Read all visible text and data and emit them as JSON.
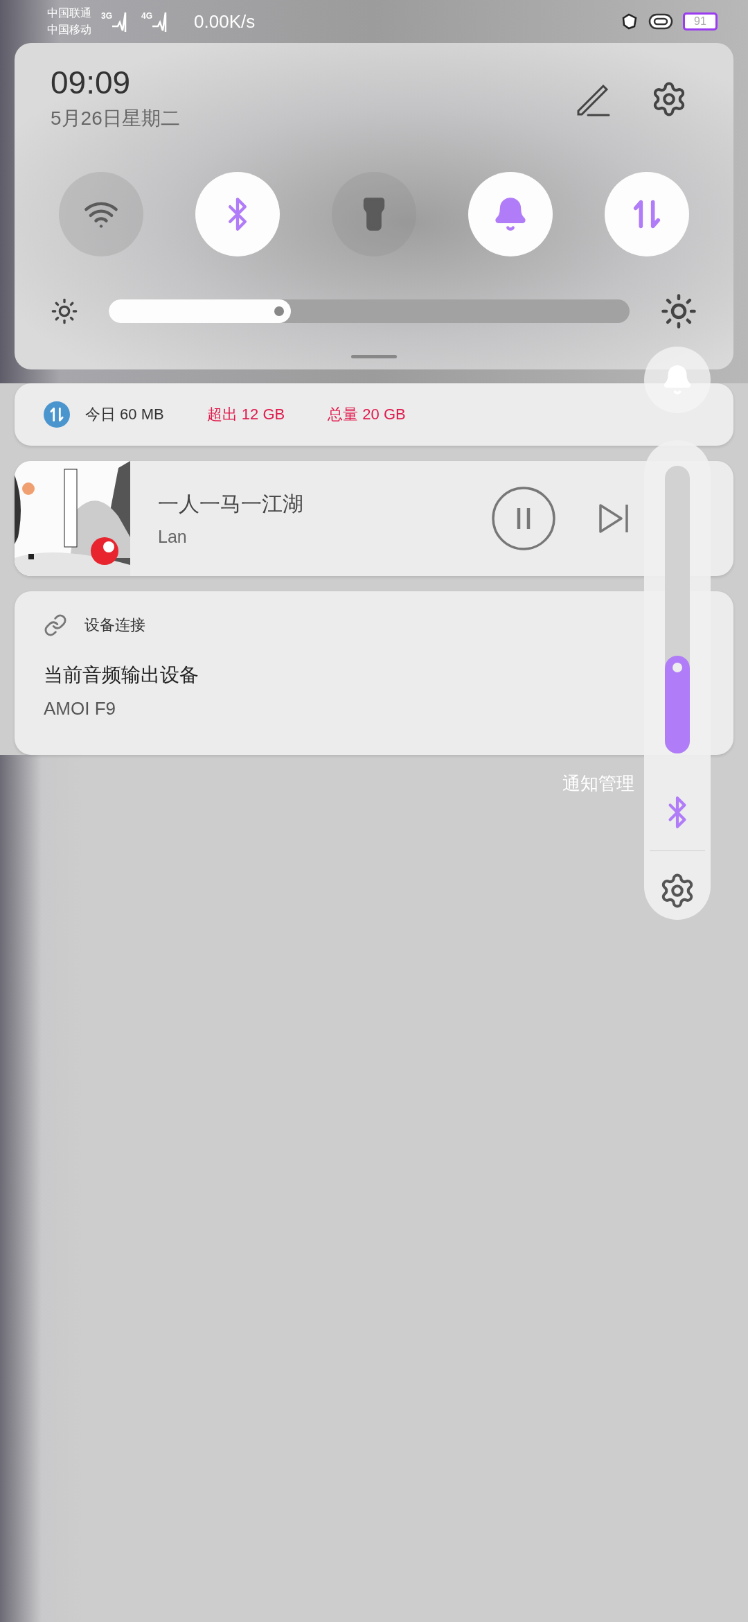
{
  "status_bar": {
    "carriers": [
      "中国联通",
      "中国移动"
    ],
    "signals": [
      {
        "label": "3G"
      },
      {
        "label": "4G"
      }
    ],
    "net_speed": "0.00K/s",
    "battery": "91"
  },
  "quick_settings": {
    "time": "09:09",
    "date": "5月26日星期二",
    "toggles": [
      {
        "kind": "wifi",
        "on": false
      },
      {
        "kind": "bluetooth",
        "on": true
      },
      {
        "kind": "flashlight",
        "on": false
      },
      {
        "kind": "bell",
        "on": true
      },
      {
        "kind": "data",
        "on": true
      }
    ],
    "brightness": {
      "level": 0.35
    }
  },
  "data_usage": {
    "today": "今日 60 MB",
    "over": "超出 12 GB",
    "total": "总量 20 GB"
  },
  "media": {
    "title": "一人一马一江湖",
    "artist": "Lan",
    "playing": true
  },
  "device_card": {
    "header": "设备连接",
    "title": "当前音频输出设备",
    "device": "AMOI F9"
  },
  "notification_manage": "通知管理",
  "volume_panel": {
    "level": 0.34
  }
}
